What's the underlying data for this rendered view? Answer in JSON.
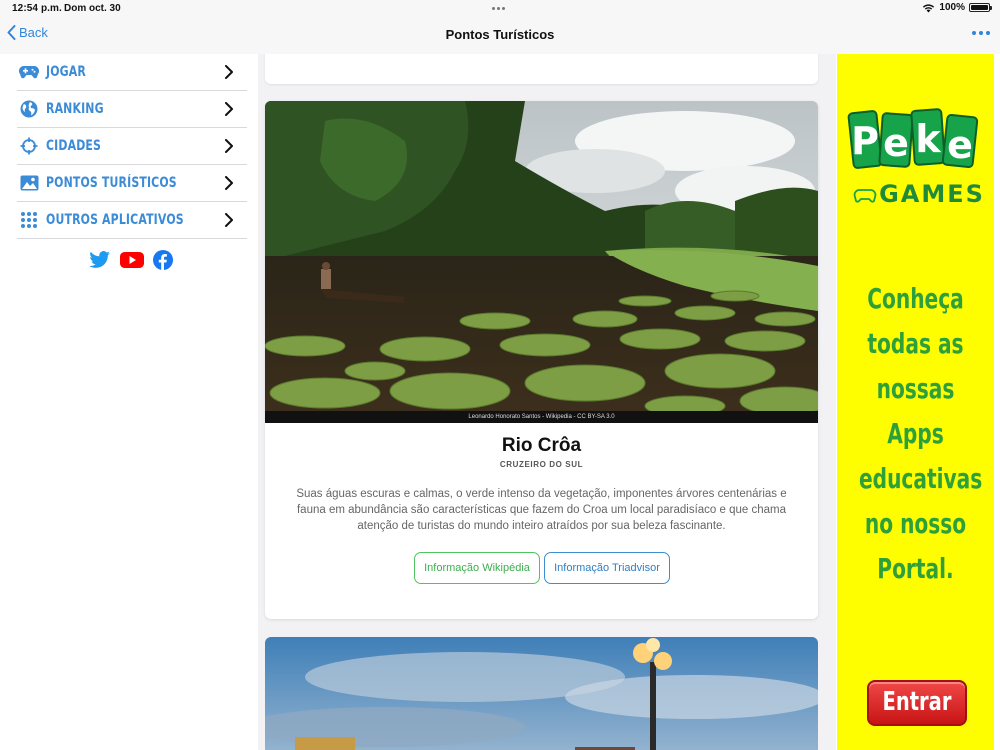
{
  "status": {
    "time": "12:54 p.m.",
    "date": "Dom oct. 30",
    "battery": "100%"
  },
  "nav": {
    "back_label": "Back",
    "title": "Pontos Turísticos"
  },
  "sidebar": {
    "items": [
      {
        "label": "JOGAR",
        "icon": "gamepad-icon"
      },
      {
        "label": "RANKING",
        "icon": "globe-icon"
      },
      {
        "label": "CIDADES",
        "icon": "crosshair-icon"
      },
      {
        "label": "PONTOS TURÍSTICOS",
        "icon": "image-icon"
      },
      {
        "label": "OUTROS APLICATIVOS",
        "icon": "apps-grid-icon"
      }
    ],
    "social": [
      "twitter-icon",
      "youtube-icon",
      "facebook-icon"
    ]
  },
  "card": {
    "photo_credit": "Leonardo Honorato Santos - Wikipedia - CC BY-SA 3.0",
    "title": "Rio Crôa",
    "subtitle": "CRUZEIRO DO SUL",
    "description": "Suas águas escuras e calmas, o verde intenso da vegetação, imponentes árvores centenárias e fauna em abundância são características que fazem do Croa um local paradisíaco e que chama atenção de turistas do mundo inteiro atraídos por sua beleza fascinante.",
    "btn_wiki": "Informação Wikipédia",
    "btn_trip": "Informação Triadvisor"
  },
  "ad": {
    "brand_top": "Peke",
    "brand_bottom": "GAMES",
    "text": "Conheça\ntodas as\nnossas Apps\neducativas\nno nosso\nPortal.",
    "button": "Entrar"
  },
  "colors": {
    "accent": "#2f86d9",
    "ad_bg": "#fefe00",
    "ad_green": "#2ea03a",
    "wiki_green": "#3fae4f"
  }
}
